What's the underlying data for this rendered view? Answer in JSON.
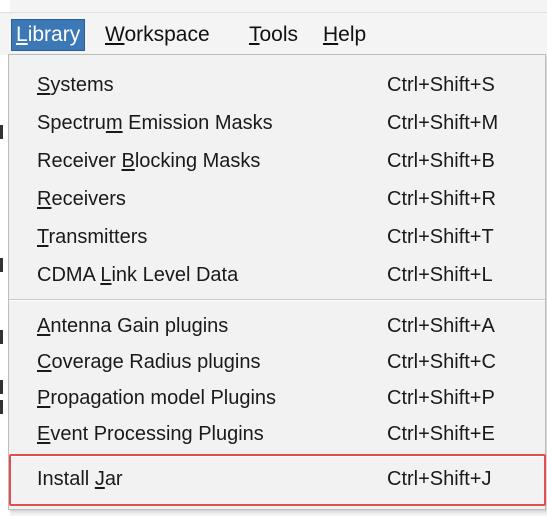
{
  "menubar": {
    "library": {
      "pre": "",
      "mnemonic": "L",
      "post": "ibrary"
    },
    "workspace": {
      "pre": "",
      "mnemonic": "W",
      "post": "orkspace"
    },
    "tools": {
      "pre": "",
      "mnemonic": "T",
      "post": "ools"
    },
    "help": {
      "pre": "",
      "mnemonic": "H",
      "post": "elp"
    }
  },
  "colors": {
    "active_menu_bg": "#3c78b5",
    "highlight_border": "#e05050"
  },
  "library_menu": {
    "items": [
      {
        "pre": "",
        "mnemonic": "S",
        "post": "ystems",
        "accel": "Ctrl+Shift+S"
      },
      {
        "pre": "Spectru",
        "mnemonic": "m",
        "post": " Emission Masks",
        "accel": "Ctrl+Shift+M"
      },
      {
        "pre": "Receiver ",
        "mnemonic": "B",
        "post": "locking Masks",
        "accel": "Ctrl+Shift+B"
      },
      {
        "pre": "",
        "mnemonic": "R",
        "post": "eceivers",
        "accel": "Ctrl+Shift+R"
      },
      {
        "pre": "",
        "mnemonic": "T",
        "post": "ransmitters",
        "accel": "Ctrl+Shift+T"
      },
      {
        "pre": "CDMA ",
        "mnemonic": "L",
        "post": "ink Level Data",
        "accel": "Ctrl+Shift+L"
      },
      {
        "pre": "",
        "mnemonic": "A",
        "post": "ntenna Gain plugins",
        "accel": "Ctrl+Shift+A"
      },
      {
        "pre": "",
        "mnemonic": "C",
        "post": "overage Radius plugins",
        "accel": "Ctrl+Shift+C"
      },
      {
        "pre": "",
        "mnemonic": "P",
        "post": "ropagation model Plugins",
        "accel": "Ctrl+Shift+P"
      },
      {
        "pre": "",
        "mnemonic": "E",
        "post": "vent Processing Plugins",
        "accel": "Ctrl+Shift+E"
      },
      {
        "pre": "Install ",
        "mnemonic": "J",
        "post": "ar",
        "accel": "Ctrl+Shift+J"
      }
    ]
  }
}
